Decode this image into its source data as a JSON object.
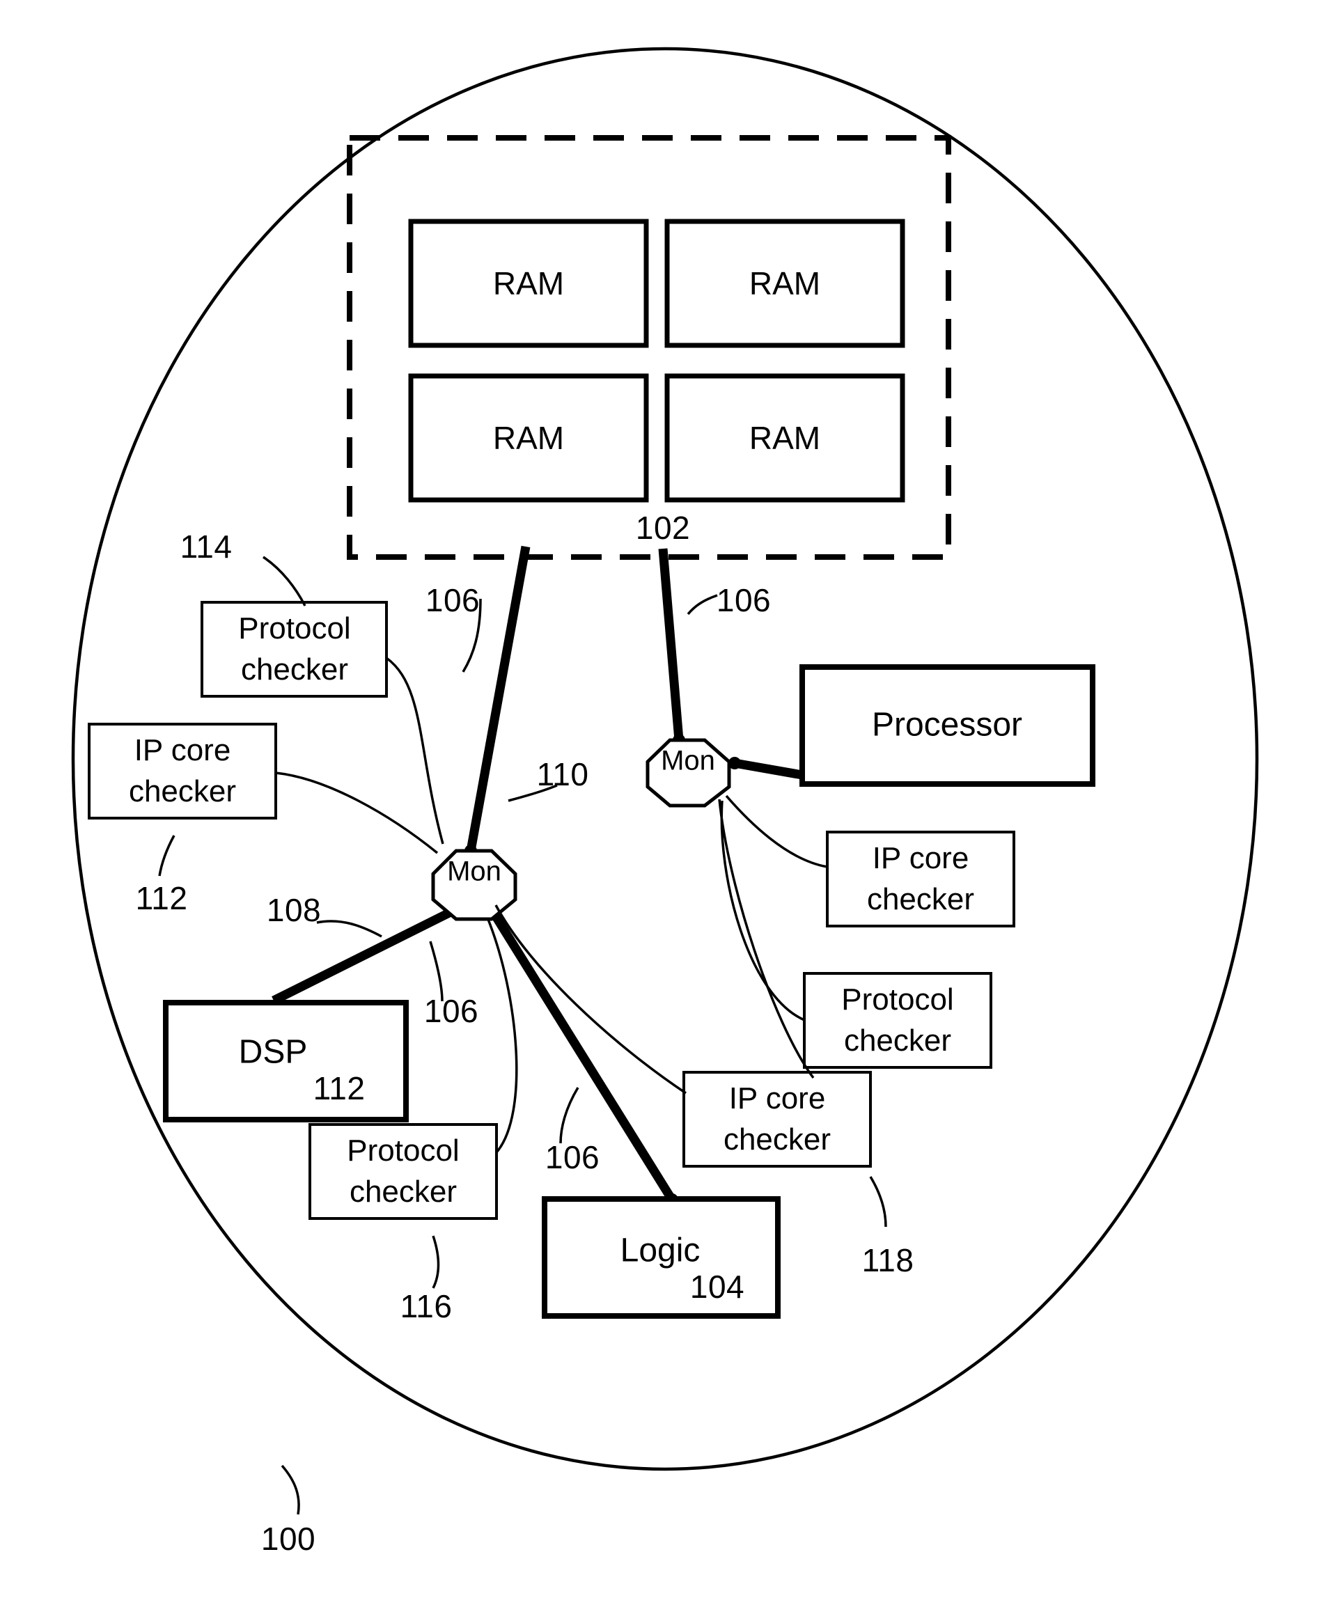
{
  "figure": {
    "type": "patent-block-diagram",
    "description": "System-on-chip block diagram with monitor nodes, checkers, memory, processor, DSP and logic blocks",
    "stroke_color": "#000000",
    "background_color": "#ffffff"
  },
  "outer_boundary": {
    "name": "system-boundary-ellipse",
    "numeral": "100"
  },
  "memory_group": {
    "name": "memory-subsystem",
    "numeral": "102",
    "blocks": [
      {
        "label": "RAM"
      },
      {
        "label": "RAM"
      },
      {
        "label": "RAM"
      },
      {
        "label": "RAM"
      }
    ]
  },
  "nodes": [
    {
      "name": "monitor-left",
      "label": "Mon",
      "numeral": "110"
    },
    {
      "name": "monitor-right",
      "label": "Mon",
      "numeral": ""
    }
  ],
  "blocks": [
    {
      "name": "processor-block",
      "label": "Processor",
      "numeral": ""
    },
    {
      "name": "dsp-block",
      "label": "DSP",
      "numeral": "112"
    },
    {
      "name": "logic-block",
      "label": "Logic",
      "numeral": "104"
    }
  ],
  "checkers": [
    {
      "name": "protocol-checker-upper-left",
      "line1": "Protocol",
      "line2": "checker",
      "numeral": "114"
    },
    {
      "name": "ip-core-checker-left",
      "line1": "IP core",
      "line2": "checker",
      "numeral": "112"
    },
    {
      "name": "ip-core-checker-right",
      "line1": "IP core",
      "line2": "checker",
      "numeral": ""
    },
    {
      "name": "protocol-checker-right",
      "line1": "Protocol",
      "line2": "checker",
      "numeral": ""
    },
    {
      "name": "ip-core-checker-center",
      "line1": "IP core",
      "line2": "checker",
      "numeral": "118"
    },
    {
      "name": "protocol-checker-lower-left",
      "line1": "Protocol",
      "line2": "checker",
      "numeral": "116"
    }
  ],
  "bus_numerals": [
    {
      "name": "bus-numeral-memory-link",
      "value": "106"
    },
    {
      "name": "bus-numeral-processor-link",
      "value": "106"
    },
    {
      "name": "bus-numeral-dsp-link",
      "value": "106"
    },
    {
      "name": "bus-numeral-logic-link",
      "value": "106"
    }
  ],
  "link_numerals": [
    {
      "name": "link-numeral-dsp",
      "value": "108"
    }
  ],
  "reference_numerals": {
    "system": "100",
    "memory_group": "102",
    "logic": "104",
    "bus": "106",
    "link": "108",
    "monitor": "110",
    "ip_core_checker": "112",
    "protocol_checker_upper": "114",
    "protocol_checker_lower": "116",
    "ip_core_checker_center": "118"
  }
}
